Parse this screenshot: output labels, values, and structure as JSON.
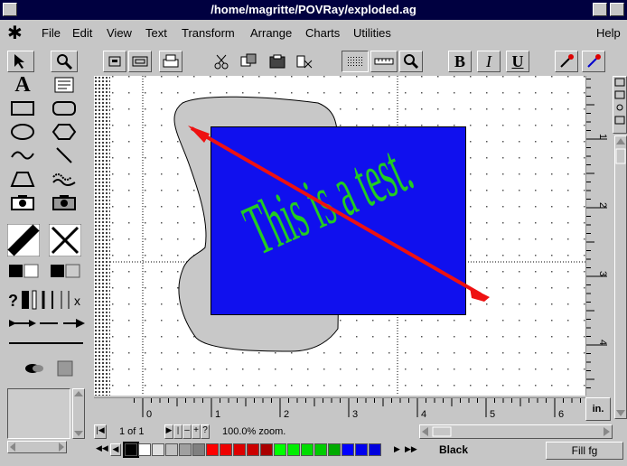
{
  "window": {
    "title": "/home/magritte/POVRay/exploded.ag"
  },
  "menu": {
    "logo": "✱",
    "items": [
      "File",
      "Edit",
      "View",
      "Text",
      "Transform",
      "Arrange",
      "Charts",
      "Utilities"
    ],
    "help": "Help"
  },
  "toolbar": {
    "bold_label": "B",
    "italic_label": "I",
    "underline_label": "U"
  },
  "tools": {
    "text_tool_label": "A",
    "query_label": "?"
  },
  "canvas": {
    "text_object": "This is a test.",
    "rect_color": "#1010ee",
    "text_color": "#22cc22",
    "arrow_color": "#ee1111",
    "blob_color": "#c8c8c8"
  },
  "ruler": {
    "h_labels": [
      "0",
      "1",
      "2",
      "3",
      "4",
      "5",
      "6"
    ],
    "v_labels": [
      "1",
      "2",
      "3",
      "4"
    ],
    "units_button": "in."
  },
  "status": {
    "page": "1 of 1",
    "zoom": "100.0% zoom."
  },
  "palette": {
    "color_name": "Black",
    "fill_mode": "Fill fg",
    "swatches": [
      "#000000",
      "#ffffff",
      "#e0e0e0",
      "#c0c0c0",
      "#a0a0a0",
      "#808080",
      "#ff0000",
      "#ee0000",
      "#dd0000",
      "#cc0000",
      "#aa0000",
      "#00ff00",
      "#00ee00",
      "#00dd00",
      "#00cc00",
      "#00aa00",
      "#0000ff",
      "#0000ee",
      "#0000dd"
    ]
  }
}
